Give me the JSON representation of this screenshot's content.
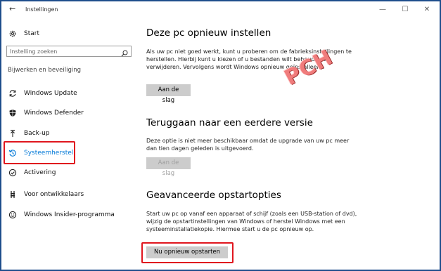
{
  "window": {
    "title": "Instellingen",
    "controls": {
      "minimize": "—",
      "maximize": "☐",
      "close": "✕"
    }
  },
  "nav": {
    "start_label": "Start",
    "search": {
      "placeholder": "Instelling zoeken"
    },
    "section_label": "Bijwerken en beveiliging",
    "items": [
      {
        "label": "Windows Update",
        "icon": "sync-icon"
      },
      {
        "label": "Windows Defender",
        "icon": "shield-icon"
      },
      {
        "label": "Back-up",
        "icon": "backup-arrow-icon"
      },
      {
        "label": "Systeemherstel",
        "icon": "history-icon",
        "selected": true
      },
      {
        "label": "Activering",
        "icon": "check-circle-icon"
      },
      {
        "label": "Voor ontwikkelaars",
        "icon": "developer-tools-icon"
      },
      {
        "label": "Windows Insider-programma",
        "icon": "smiley-icon"
      }
    ]
  },
  "main": {
    "sections": [
      {
        "heading": "Deze pc opnieuw instellen",
        "text": "Als uw pc niet goed werkt, kunt u proberen om de fabrieksinstellingen te herstellen. Hierbij kunt u kiezen of u bestanden wilt behouden of verwijderen. Vervolgens wordt Windows opnieuw geïnstalleerd.",
        "button": "Aan de slag"
      },
      {
        "heading": "Teruggaan naar een eerdere versie",
        "text": "Deze optie is niet meer beschikbaar omdat de upgrade van uw pc meer dan tien dagen geleden is uitgevoerd.",
        "button": "Aan de slag"
      },
      {
        "heading": "Geavanceerde opstartopties",
        "text": "Start uw pc op vanaf een apparaat of schijf (zoals een USB-station of dvd), wijzig de opstartinstellingen van Windows of herstel Windows met een systeeminstallatiekopie. Hiermee start u de pc opnieuw op.",
        "button": "Nu opnieuw opstarten"
      }
    ]
  },
  "watermark": "PCH",
  "colors": {
    "accent": "#0078d7",
    "highlight_box": "#e0161e",
    "frame": "#1f4e8c",
    "watermark": "#f07c7c"
  }
}
